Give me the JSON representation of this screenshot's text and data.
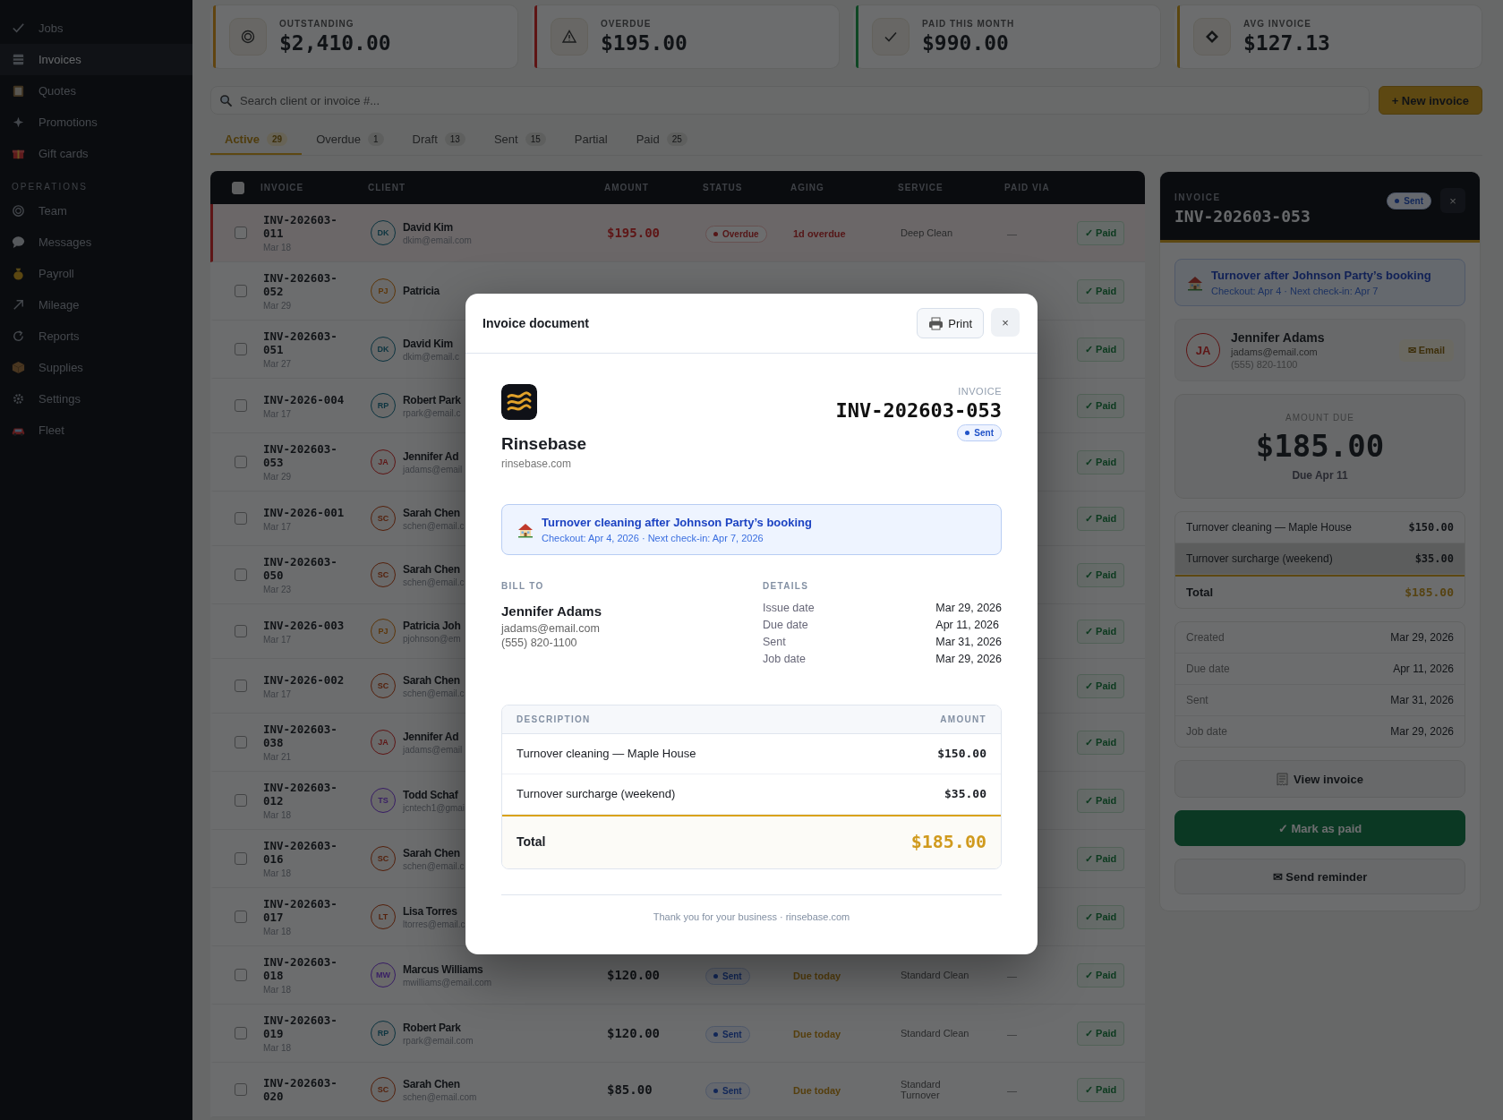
{
  "sidebar": {
    "groups": [
      {
        "items": [
          {
            "label": "Jobs",
            "selected": false
          },
          {
            "label": "Invoices",
            "selected": true
          },
          {
            "label": "Quotes",
            "selected": false
          },
          {
            "label": "Promotions",
            "selected": false
          },
          {
            "label": "Gift cards",
            "selected": false
          }
        ]
      },
      {
        "heading": "OPERATIONS",
        "items": [
          {
            "label": "Team",
            "selected": false
          },
          {
            "label": "Messages",
            "selected": false
          },
          {
            "label": "Payroll",
            "selected": false
          },
          {
            "label": "Mileage",
            "selected": false
          },
          {
            "label": "Reports",
            "selected": false
          },
          {
            "label": "Supplies",
            "selected": false
          },
          {
            "label": "Settings",
            "selected": false
          },
          {
            "label": "Fleet",
            "selected": false
          }
        ]
      }
    ]
  },
  "stats": [
    {
      "label": "OUTSTANDING",
      "value": "$2,410.00",
      "color": "#604410"
    },
    {
      "label": "OVERDUE",
      "value": "$195.00",
      "color": "#5e1515"
    },
    {
      "label": "PAID THIS MONTH",
      "value": "$990.00",
      "color": "#0f4724"
    },
    {
      "label": "AVG INVOICE",
      "value": "$127.13",
      "color": "#5b460f"
    }
  ],
  "search": {
    "placeholder": "Search client or invoice #..."
  },
  "new_button": "+ New invoice",
  "tabs": [
    {
      "label": "Active",
      "count": "29",
      "selected": true
    },
    {
      "label": "Overdue",
      "count": "1",
      "selected": false
    },
    {
      "label": "Draft",
      "count": "13",
      "selected": false
    },
    {
      "label": "Sent",
      "count": "15",
      "selected": false
    },
    {
      "label": "Partial",
      "selected": false
    },
    {
      "label": "Paid",
      "count": "25",
      "selected": false
    }
  ],
  "table": {
    "select_all_checked": false,
    "columns": [
      "INVOICE",
      "CLIENT",
      "AMOUNT",
      "STATUS",
      "AGING",
      "SERVICE",
      "PAID VIA"
    ],
    "rows": [
      {
        "checked": false,
        "flagged": true,
        "invoice": "INV-202603-011",
        "date": "Mar 18",
        "initials": "DK",
        "color": "#0c3440",
        "client": "David Kim",
        "email": "dkim@email.com",
        "amount": "$195.00",
        "status": {
          "label": "Overdue",
          "kind": "overdue"
        },
        "aging": "1d overdue",
        "service": "Deep Clean",
        "paid_via": "—",
        "action": "✓ Paid"
      },
      {
        "checked": false,
        "flagged": false,
        "invoice": "INV-202603-052",
        "date": "Mar 29",
        "initials": "PJ",
        "color": "#5d3608",
        "client": "Patricia",
        "action": "✓ Paid"
      },
      {
        "checked": false,
        "flagged": false,
        "invoice": "INV-202603-051",
        "date": "Mar 27",
        "initials": "DK",
        "color": "#0c3440",
        "client": "David Kim",
        "email": "dkim@email.c",
        "action": "✓ Paid"
      },
      {
        "checked": false,
        "flagged": false,
        "invoice": "INV-2026-004",
        "date": "Mar 17",
        "initials": "RP",
        "color": "#0c3440",
        "client": "Robert Park",
        "email": "rpark@email.c",
        "action": "✓ Paid"
      },
      {
        "checked": false,
        "flagged": false,
        "invoice": "INV-202603-053",
        "date": "Mar 29",
        "initials": "JA",
        "color": "#5e1515",
        "client": "Jennifer Ad",
        "email": "jadams@email",
        "action": "✓ Paid"
      },
      {
        "checked": false,
        "flagged": false,
        "invoice": "INV-2026-001",
        "date": "Mar 17",
        "initials": "SC",
        "color": "#54200b",
        "client": "Sarah Chen",
        "email": "schen@email.c",
        "action": "✓ Paid"
      },
      {
        "checked": false,
        "flagged": false,
        "invoice": "INV-202603-050",
        "date": "Mar 23",
        "initials": "SC",
        "color": "#54200b",
        "client": "Sarah Chen",
        "email": "schen@email.c",
        "action": "✓ Paid"
      },
      {
        "checked": false,
        "flagged": false,
        "invoice": "INV-2026-003",
        "date": "Mar 17",
        "initials": "PJ",
        "color": "#5d3608",
        "client": "Patricia Joh",
        "email": "pjohnson@em",
        "action": "✓ Paid"
      },
      {
        "checked": false,
        "flagged": false,
        "invoice": "INV-2026-002",
        "date": "Mar 17",
        "initials": "SC",
        "color": "#54200b",
        "client": "Sarah Chen",
        "email": "schen@email.c",
        "action": "✓ Paid"
      },
      {
        "checked": false,
        "flagged": false,
        "invoice": "INV-202603-038",
        "date": "Mar 21",
        "initials": "JA",
        "color": "#5e1515",
        "client": "Jennifer Ad",
        "email": "jadams@email",
        "action": "✓ Paid"
      },
      {
        "checked": false,
        "flagged": false,
        "invoice": "INV-202603-012",
        "date": "Mar 18",
        "initials": "TS",
        "color": "#381d65",
        "client": "Todd Schaf",
        "email": "jcntech1@gmai",
        "action": "✓ Paid"
      },
      {
        "checked": false,
        "flagged": false,
        "invoice": "INV-202603-016",
        "date": "Mar 18",
        "initials": "SC",
        "color": "#54200b",
        "client": "Sarah Chen",
        "email": "schen@email.c",
        "action": "✓ Paid"
      },
      {
        "checked": false,
        "flagged": false,
        "invoice": "INV-202603-017",
        "date": "Mar 18",
        "initials": "LT",
        "color": "#54200b",
        "client": "Lisa Torres",
        "email": "ltorres@email.c",
        "action": "✓ Paid"
      },
      {
        "checked": false,
        "flagged": false,
        "invoice": "INV-202603-018",
        "date": "Mar 18",
        "initials": "MW",
        "color": "#381d65",
        "client": "Marcus Williams",
        "email": "mwilliams@email.com",
        "amount": "$120.00",
        "status": {
          "label": "Sent",
          "kind": "sent"
        },
        "aging": "Due today",
        "service": "Standard Clean",
        "paid_via": "—",
        "action": "✓ Paid"
      },
      {
        "checked": false,
        "flagged": false,
        "invoice": "INV-202603-019",
        "date": "Mar 18",
        "initials": "RP",
        "color": "#0c3440",
        "client": "Robert Park",
        "email": "rpark@email.com",
        "amount": "$120.00",
        "status": {
          "label": "Sent",
          "kind": "sent"
        },
        "aging": "Due today",
        "service": "Standard Clean",
        "paid_via": "—",
        "action": "✓ Paid"
      },
      {
        "checked": false,
        "flagged": false,
        "invoice": "INV-202603-020",
        "initials": "SC",
        "color": "#54200b",
        "client": "Sarah Chen",
        "email": "schen@email.com",
        "amount": "$85.00",
        "status": {
          "label": "Sent",
          "kind": "sent"
        },
        "aging": "Due today",
        "service": "Standard Turnover",
        "paid_via": "—",
        "action": "✓ Paid"
      }
    ]
  },
  "detail_panel": {
    "label": "INVOICE",
    "number": "INV-202603-053",
    "status": {
      "label": "Sent",
      "kind": "sent"
    },
    "close": "×",
    "booking": {
      "title": "Turnover after Johnson Party’s booking",
      "subtitle": "Checkout: Apr 4 · Next check-in: Apr 7"
    },
    "client": {
      "initials": "JA",
      "color": "#5e1515",
      "name": "Jennifer Adams",
      "email": "jadams@email.com",
      "phone": "(555) 820-1100",
      "action": "✉ Email"
    },
    "amount_due": {
      "label": "AMOUNT DUE",
      "value": "$185.00",
      "due": "Due Apr 11"
    },
    "lines": [
      {
        "description": "Turnover cleaning — Maple House",
        "amount": "$150.00",
        "hovered": false
      },
      {
        "description": "Turnover surcharge (weekend)",
        "amount": "$35.00",
        "hovered": true
      }
    ],
    "total": {
      "label": "Total",
      "amount": "$185.00"
    },
    "dates": [
      {
        "label": "Created",
        "value": "Mar 29, 2026"
      },
      {
        "label": "Due date",
        "value": "Apr 11, 2026"
      },
      {
        "label": "Sent",
        "value": "Mar 31, 2026"
      },
      {
        "label": "Job date",
        "value": "Mar 29, 2026"
      }
    ],
    "buttons": [
      {
        "label": "View invoice",
        "kind": "view"
      },
      {
        "label": "✓ Mark as paid",
        "kind": "primary"
      },
      {
        "label": "✉ Send reminder",
        "kind": "secondary"
      }
    ]
  },
  "modal": {
    "title": "Invoice document",
    "print": "Print",
    "close": "×",
    "brand": {
      "name": "Rinsebase",
      "site": "rinsebase.com"
    },
    "doc_label": "INVOICE",
    "number": "INV-202603-053",
    "status": {
      "label": "Sent",
      "kind": "sent"
    },
    "booking": {
      "title": "Turnover cleaning after Johnson Party’s booking",
      "subtitle": "Checkout: Apr 4, 2026 · Next check-in: Apr 7, 2026"
    },
    "bill_to": {
      "heading": "BILL TO",
      "name": "Jennifer Adams",
      "email": "jadams@email.com",
      "phone": "(555) 820-1100"
    },
    "details": {
      "heading": "DETAILS",
      "rows": [
        {
          "label": "Issue date",
          "value": "Mar 29, 2026"
        },
        {
          "label": "Due date",
          "value": "Apr 11, 2026"
        },
        {
          "label": "Sent",
          "value": "Mar 31, 2026"
        },
        {
          "label": "Job date",
          "value": "Mar 29, 2026"
        }
      ]
    },
    "lines": {
      "columns": [
        "DESCRIPTION",
        "AMOUNT"
      ],
      "rows": [
        {
          "description": "Turnover cleaning — Maple House",
          "amount": "$150.00"
        },
        {
          "description": "Turnover surcharge (weekend)",
          "amount": "$35.00"
        }
      ],
      "total": {
        "label": "Total",
        "amount": "$185.00"
      }
    },
    "footer": "Thank you for your business · rinsebase.com"
  }
}
